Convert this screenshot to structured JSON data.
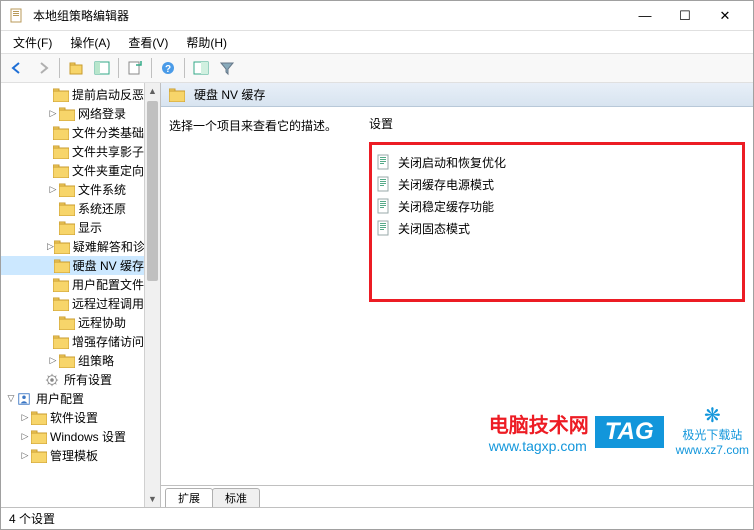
{
  "window": {
    "title": "本地组策略编辑器"
  },
  "menu": {
    "file": "文件(F)",
    "action": "操作(A)",
    "view": "查看(V)",
    "help": "帮助(H)"
  },
  "tree": {
    "items": [
      {
        "label": "提前启动反恶",
        "indent": 3,
        "expander": ""
      },
      {
        "label": "网络登录",
        "indent": 3,
        "expander": "▷"
      },
      {
        "label": "文件分类基础",
        "indent": 3,
        "expander": ""
      },
      {
        "label": "文件共享影子",
        "indent": 3,
        "expander": ""
      },
      {
        "label": "文件夹重定向",
        "indent": 3,
        "expander": ""
      },
      {
        "label": "文件系统",
        "indent": 3,
        "expander": "▷"
      },
      {
        "label": "系统还原",
        "indent": 3,
        "expander": ""
      },
      {
        "label": "显示",
        "indent": 3,
        "expander": ""
      },
      {
        "label": "疑难解答和诊",
        "indent": 3,
        "expander": "▷"
      },
      {
        "label": "硬盘 NV 缓存",
        "indent": 3,
        "expander": "",
        "selected": true
      },
      {
        "label": "用户配置文件",
        "indent": 3,
        "expander": ""
      },
      {
        "label": "远程过程调用",
        "indent": 3,
        "expander": ""
      },
      {
        "label": "远程协助",
        "indent": 3,
        "expander": ""
      },
      {
        "label": "增强存储访问",
        "indent": 3,
        "expander": ""
      },
      {
        "label": "组策略",
        "indent": 3,
        "expander": "▷"
      },
      {
        "label": "所有设置",
        "indent": 2,
        "expander": "",
        "icon": "gear"
      },
      {
        "label": "用户配置",
        "indent": 0,
        "expander": "▽",
        "icon": "user"
      },
      {
        "label": "软件设置",
        "indent": 1,
        "expander": "▷"
      },
      {
        "label": "Windows 设置",
        "indent": 1,
        "expander": "▷"
      },
      {
        "label": "管理模板",
        "indent": 1,
        "expander": "▷"
      }
    ]
  },
  "right": {
    "header": "硬盘 NV 缓存",
    "description_prompt": "选择一个项目来查看它的描述。",
    "settings_header": "设置",
    "settings": [
      "关闭启动和恢复优化",
      "关闭缓存电源模式",
      "关闭稳定缓存功能",
      "关闭固态模式"
    ]
  },
  "tabs": {
    "extended": "扩展",
    "standard": "标准"
  },
  "status": "4 个设置",
  "watermark": {
    "line1": "电脑技术网",
    "line2": "www.tagxp.com",
    "tag": "TAG",
    "site2": "极光下载站",
    "url2": "www.xz7.com"
  }
}
